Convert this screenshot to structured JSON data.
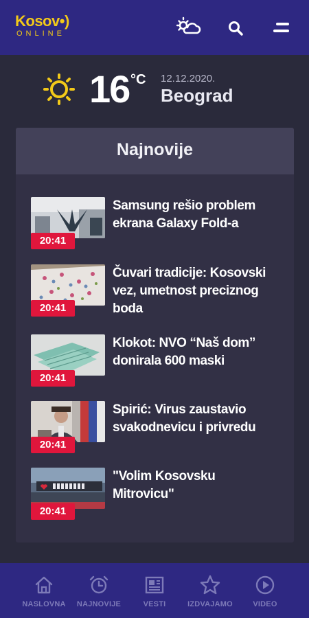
{
  "header": {
    "logo_main": "Kosov•)",
    "logo_sub": "ONLINE"
  },
  "weather": {
    "temperature": "16",
    "unit": "°C",
    "date": "12.12.2020.",
    "city": "Beograd",
    "icon": "sun-icon"
  },
  "panel": {
    "title": "Najnovije"
  },
  "articles": [
    {
      "time": "20:41",
      "headline": "Samsung rešio problem ekrana Galaxy Fold-a"
    },
    {
      "time": "20:41",
      "headline": "Čuvari tradicije: Kosovski vez, umetnost preciznog boda"
    },
    {
      "time": "20:41",
      "headline": "Klokot: NVO “Naš dom” donirala 600 maski"
    },
    {
      "time": "20:41",
      "headline": "Spirić: Virus zaustavio svakodnevicu i privredu"
    },
    {
      "time": "20:41",
      "headline": "\"Volim Kosovsku Mitrovicu\""
    }
  ],
  "nav": [
    {
      "label": "NASLOVNA",
      "icon": "home-icon"
    },
    {
      "label": "NAJNOVIJE",
      "icon": "alarm-clock-icon"
    },
    {
      "label": "VESTI",
      "icon": "newspaper-icon"
    },
    {
      "label": "IZDVAJAMO",
      "icon": "star-icon"
    },
    {
      "label": "VIDEO",
      "icon": "play-icon"
    }
  ],
  "colors": {
    "brand": "#2e2882",
    "accent_yellow": "#f2c919",
    "badge_red": "#e0163c",
    "background": "#2a2a3b"
  }
}
